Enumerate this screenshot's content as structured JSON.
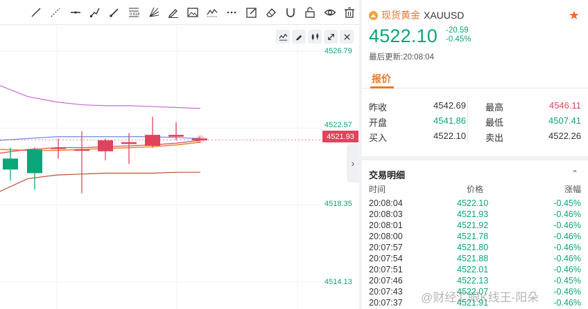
{
  "toolbar": {
    "tools": [
      "trend-line-icon",
      "ray-icon",
      "horizontal-line-icon",
      "polyline-icon",
      "brush-icon",
      "fibonacci-icon",
      "fan-icon",
      "pencil-icon",
      "image-icon",
      "pattern-icon",
      "more-icon",
      "text-edit-icon",
      "eraser-icon",
      "magnet-icon",
      "lock-icon",
      "eye-icon",
      "trash-icon"
    ],
    "fib_label": "0.618"
  },
  "chart": {
    "price_ticks": [
      "4526.79",
      "4522.57",
      "4518.35",
      "4514.13"
    ],
    "last_price": "4521.93",
    "colors": {
      "up": "#0aa57a",
      "down": "#e0435b",
      "upper_band": "#c86ad0",
      "lower_band": "#b5502c",
      "ma_mid": "#6a8ae0",
      "ma_fast": "#e88a2c",
      "ma_slow": "#e0435b"
    }
  },
  "chart_data": {
    "type": "candlestick",
    "y_axis_ticks": [
      4526.79,
      4522.57,
      4518.35,
      4514.13
    ],
    "candles": [
      {
        "open": 4520.9,
        "close": 4520.3,
        "high": 4521.5,
        "low": 4519.7
      },
      {
        "open": 4521.4,
        "close": 4520.1,
        "high": 4521.5,
        "low": 4519.2
      },
      {
        "open": 4521.5,
        "close": 4521.5,
        "high": 4522.0,
        "low": 4520.9
      },
      {
        "open": 4521.4,
        "close": 4521.4,
        "high": 4522.4,
        "low": 4519.0
      },
      {
        "open": 4521.3,
        "close": 4521.9,
        "high": 4522.0,
        "low": 4520.8
      },
      {
        "open": 4521.7,
        "close": 4521.8,
        "high": 4522.3,
        "low": 4520.6
      },
      {
        "open": 4521.6,
        "close": 4522.2,
        "high": 4523.2,
        "low": 4521.5
      },
      {
        "open": 4522.1,
        "close": 4522.2,
        "high": 4522.9,
        "low": 4521.9
      },
      {
        "open": 4521.9,
        "close": 4522.0,
        "high": 4522.1,
        "low": 4521.9
      }
    ],
    "last_price": 4521.93
  },
  "panel": {
    "symbol_name": "现货黄金",
    "symbol_code": "XAUUSD",
    "price": "4522.10",
    "change": "-20.59",
    "change_pct": "-0.45%",
    "updated": "最后更新:20:08:04",
    "tab": "报价",
    "quotes": [
      {
        "l1": "昨收",
        "v1": "4542.69",
        "c1": "#333333",
        "l2": "最高",
        "v2": "4546.11",
        "c2": "#e0435b"
      },
      {
        "l1": "开盘",
        "v1": "4541.86",
        "c1": "#0aa57a",
        "l2": "最低",
        "v2": "4507.41",
        "c2": "#0aa57a"
      },
      {
        "l1": "买入",
        "v1": "4522.10",
        "c1": "#333333",
        "l2": "卖出",
        "v2": "4522.26",
        "c2": "#333333"
      }
    ],
    "trades_title": "交易明细",
    "trades_head": {
      "time": "时间",
      "price": "价格",
      "pct": "涨幅"
    },
    "trades": [
      {
        "time": "20:08:04",
        "price": "4522.10",
        "pct": "-0.45%"
      },
      {
        "time": "20:08:03",
        "price": "4521.93",
        "pct": "-0.46%"
      },
      {
        "time": "20:08:01",
        "price": "4521.92",
        "pct": "-0.46%"
      },
      {
        "time": "20:08:00",
        "price": "4521.78",
        "pct": "-0.46%"
      },
      {
        "time": "20:07:57",
        "price": "4521.80",
        "pct": "-0.46%"
      },
      {
        "time": "20:07:54",
        "price": "4521.88",
        "pct": "-0.46%"
      },
      {
        "time": "20:07:51",
        "price": "4522.01",
        "pct": "-0.46%"
      },
      {
        "time": "20:07:46",
        "price": "4522.13",
        "pct": "-0.45%"
      },
      {
        "time": "20:07:43",
        "price": "4522.07",
        "pct": "-0.46%"
      },
      {
        "time": "20:07:37",
        "price": "4521.91",
        "pct": "-0.46%"
      }
    ]
  },
  "watermark": "@财经汇眼K线王-阳朵"
}
